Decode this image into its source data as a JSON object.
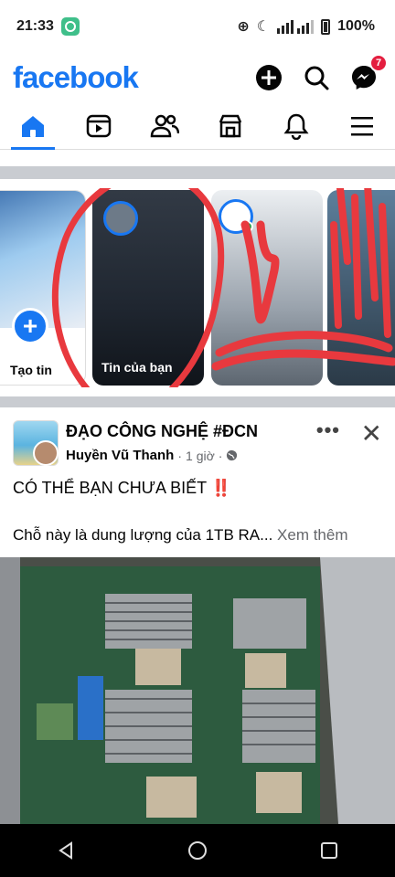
{
  "status_bar": {
    "time": "21:33",
    "battery": "100%"
  },
  "header": {
    "logo": "facebook",
    "messenger_badge": "7"
  },
  "tabs": [
    {
      "name": "home",
      "active": true
    },
    {
      "name": "video",
      "active": false
    },
    {
      "name": "friends",
      "active": false
    },
    {
      "name": "marketplace",
      "active": false
    },
    {
      "name": "notifications",
      "active": false
    },
    {
      "name": "menu",
      "active": false
    }
  ],
  "stories": {
    "create_label": "Tạo tin",
    "your_story_label": "Tin của bạn"
  },
  "post": {
    "page_name": "ĐẠO CÔNG NGHỆ #ĐCN",
    "author": "Huyền Vũ Thanh",
    "time": "1 giờ",
    "line1": "CÓ THỂ BẠN CHƯA BIẾT",
    "line1_emoji": "‼️",
    "line2": "Chỗ này là dung lượng của 1TB RA...",
    "see_more": "Xem thêm"
  },
  "colors": {
    "brand": "#1877f2",
    "badge": "#e41e3f",
    "annotation": "#e8393e"
  }
}
